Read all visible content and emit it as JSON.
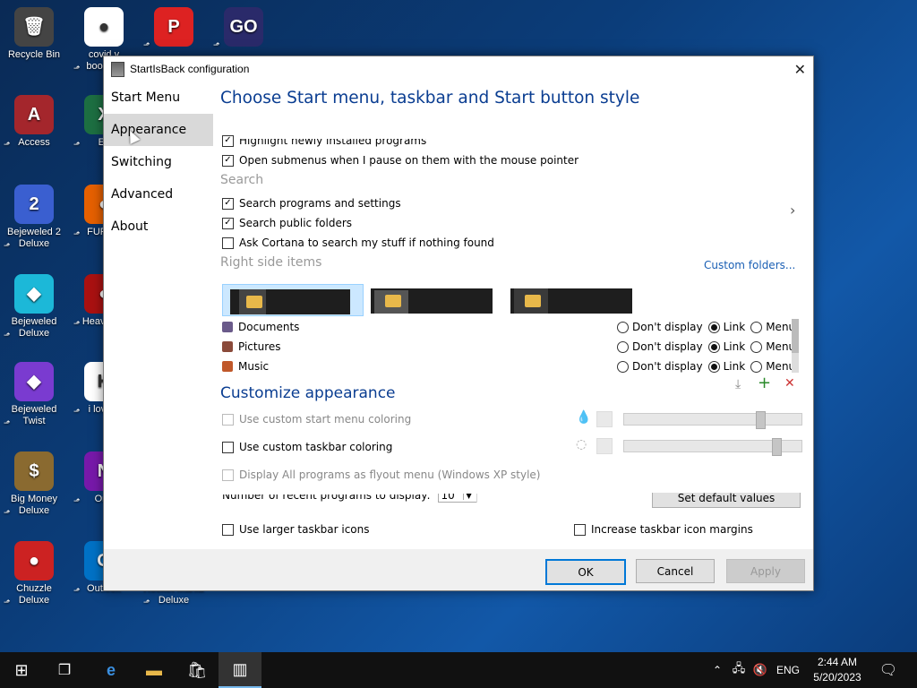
{
  "desktop": {
    "icons": [
      {
        "label": "Recycle Bin",
        "color": "#444444",
        "glyph": "🗑"
      },
      {
        "label": "covid v boosted",
        "color": "#ffffff",
        "glyph": "●"
      },
      {
        "label": "",
        "color": "#d22",
        "glyph": "P"
      },
      {
        "label": "",
        "color": "#2a2a6a",
        "glyph": "GO"
      },
      {
        "label": "Access",
        "color": "#a4262c",
        "glyph": "A"
      },
      {
        "label": "Ex",
        "color": "#1d6f42",
        "glyph": "X"
      },
      {
        "label": "Bejeweled 2 Deluxe",
        "color": "#3a5fd0",
        "glyph": "2"
      },
      {
        "label": "FURRY",
        "color": "#e66000",
        "glyph": "●"
      },
      {
        "label": "Bejeweled Deluxe",
        "color": "#1cb8d8",
        "glyph": "◆"
      },
      {
        "label": "Heavy De",
        "color": "#aa1111",
        "glyph": "●"
      },
      {
        "label": "Bejeweled Twist",
        "color": "#7a3bd0",
        "glyph": "◆"
      },
      {
        "label": "i lov ed",
        "color": "#ffffff",
        "glyph": "H"
      },
      {
        "label": "Big Money Deluxe",
        "color": "#8a6a30",
        "glyph": "$"
      },
      {
        "label": "One",
        "color": "#7719aa",
        "glyph": "N"
      },
      {
        "label": "Chuzzle Deluxe",
        "color": "#cc2222",
        "glyph": "●"
      },
      {
        "label": "Outlook",
        "color": "#0072c6",
        "glyph": "O"
      },
      {
        "label": "Rocket Mania Deluxe",
        "color": "transparent",
        "glyph": ""
      }
    ]
  },
  "dialog": {
    "title": "StartIsBack configuration",
    "close_glyph": "✕",
    "nav": [
      "Start Menu",
      "Appearance",
      "Switching",
      "Advanced",
      "About"
    ],
    "selected_nav": "Appearance",
    "heading": "Choose Start menu, taskbar and Start button style",
    "checkboxes_top": [
      {
        "label": "Highlight newly installed programs",
        "checked": true
      },
      {
        "label": "Open submenus when I pause on them with the mouse pointer",
        "checked": true
      }
    ],
    "search_section": "Search",
    "search_items": [
      {
        "label": "Search programs and settings",
        "checked": true
      },
      {
        "label": "Search public folders",
        "checked": true
      },
      {
        "label": "Ask Cortana to search my stuff if nothing found",
        "checked": false
      }
    ],
    "right_side_section": "Right side items",
    "custom_folders_link": "Custom folders...",
    "right_items": [
      {
        "label": "Documents",
        "icon_color": "#6a5a8a",
        "selected": "Link"
      },
      {
        "label": "Pictures",
        "icon_color": "#8a4a3a",
        "selected": "Link"
      },
      {
        "label": "Music",
        "icon_color": "#c0582a",
        "selected": "Link"
      }
    ],
    "radio_labels": [
      "Don't display",
      "Link",
      "Menu"
    ],
    "customize_heading": "Customize appearance",
    "custom_start_coloring": "Use custom start menu coloring",
    "custom_taskbar_coloring": "Use custom taskbar coloring",
    "display_all_programs": "Display All programs as flyout menu (Windows XP style)",
    "recent_programs_label": "Number of recent programs to display:",
    "recent_programs_value": "10",
    "set_default_values": "Set default values",
    "larger_icons": "Use larger taskbar icons",
    "increase_margins": "Increase taskbar icon margins",
    "sliders": [
      {
        "level": 0.78
      },
      {
        "level": 0.88
      }
    ],
    "buttons": {
      "ok": "OK",
      "cancel": "Cancel",
      "apply": "Apply"
    }
  },
  "taskbar": {
    "language": "ENG",
    "time": "2:44 AM",
    "date": "5/20/2023"
  },
  "colors": {
    "heading": "#0a3d91",
    "accent": "#0078d7",
    "link": "#1a5fb4"
  }
}
